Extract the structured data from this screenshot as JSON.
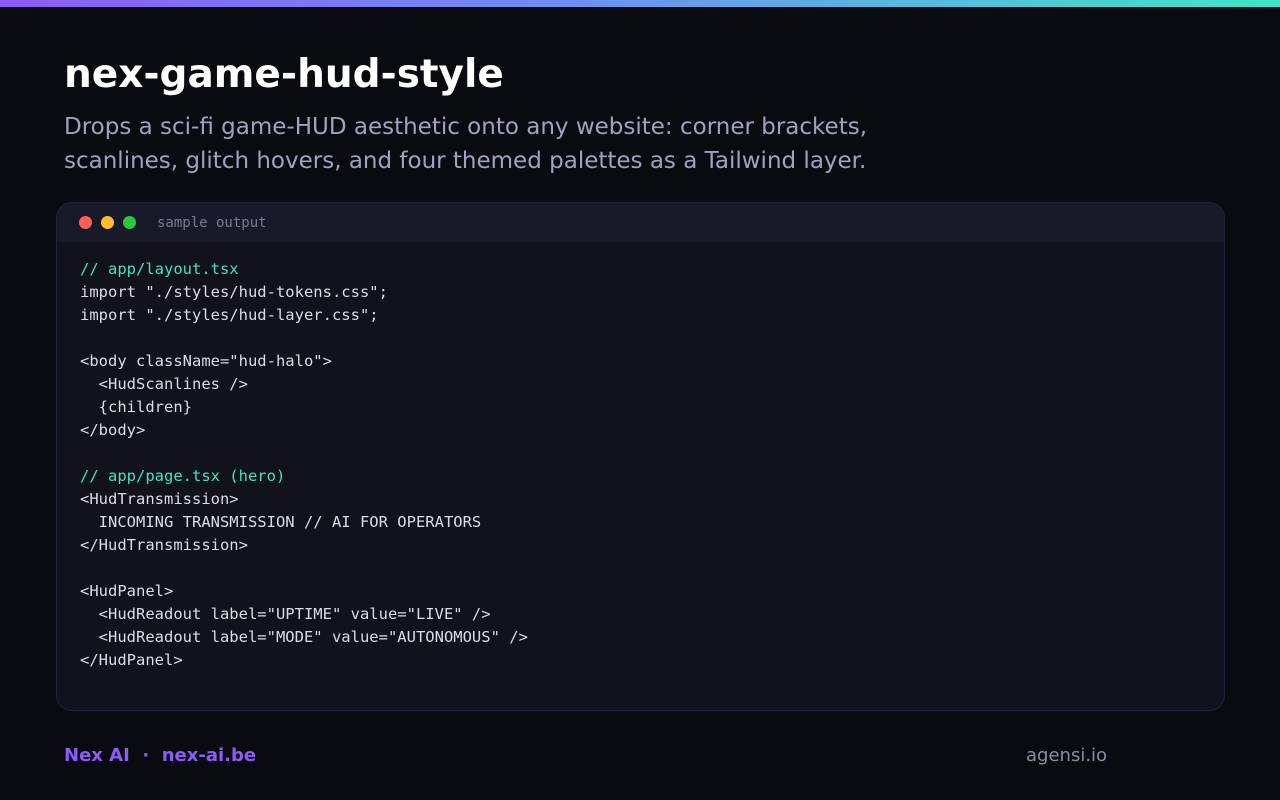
{
  "header": {
    "title": "nex-game-hud-style",
    "description": "Drops a sci-fi game-HUD aesthetic onto any website: corner brackets, scanlines, glitch hovers, and four themed palettes as a Tailwind layer."
  },
  "code_window": {
    "label": "sample output",
    "lines": [
      {
        "text": "// app/layout.tsx",
        "kind": "comment"
      },
      {
        "text": "import \"./styles/hud-tokens.css\";",
        "kind": "code"
      },
      {
        "text": "import \"./styles/hud-layer.css\";",
        "kind": "code"
      },
      {
        "text": "",
        "kind": "code"
      },
      {
        "text": "<body className=\"hud-halo\">",
        "kind": "code"
      },
      {
        "text": "  <HudScanlines />",
        "kind": "code"
      },
      {
        "text": "  {children}",
        "kind": "code"
      },
      {
        "text": "</body>",
        "kind": "code"
      },
      {
        "text": "",
        "kind": "code"
      },
      {
        "text": "// app/page.tsx (hero)",
        "kind": "comment"
      },
      {
        "text": "<HudTransmission>",
        "kind": "code"
      },
      {
        "text": "  INCOMING TRANSMISSION // AI FOR OPERATORS",
        "kind": "code"
      },
      {
        "text": "</HudTransmission>",
        "kind": "code"
      },
      {
        "text": "",
        "kind": "code"
      },
      {
        "text": "<HudPanel>",
        "kind": "code"
      },
      {
        "text": "  <HudReadout label=\"UPTIME\" value=\"LIVE\" />",
        "kind": "code"
      },
      {
        "text": "  <HudReadout label=\"MODE\" value=\"AUTONOMOUS\" />",
        "kind": "code"
      },
      {
        "text": "</HudPanel>",
        "kind": "code"
      }
    ]
  },
  "footer": {
    "brand": "Nex AI",
    "separator": "·",
    "site": "nex-ai.be",
    "credit": "agensi.io"
  },
  "colors": {
    "background": "#0a0b10",
    "accent": "#8b5cf6",
    "comment": "#41e3c2",
    "dot_red": "#ff5f56",
    "dot_yellow": "#ffbd2e",
    "dot_green": "#27c93f"
  },
  "icons": [
    "close-dot-icon",
    "minimize-dot-icon",
    "maximize-dot-icon"
  ]
}
